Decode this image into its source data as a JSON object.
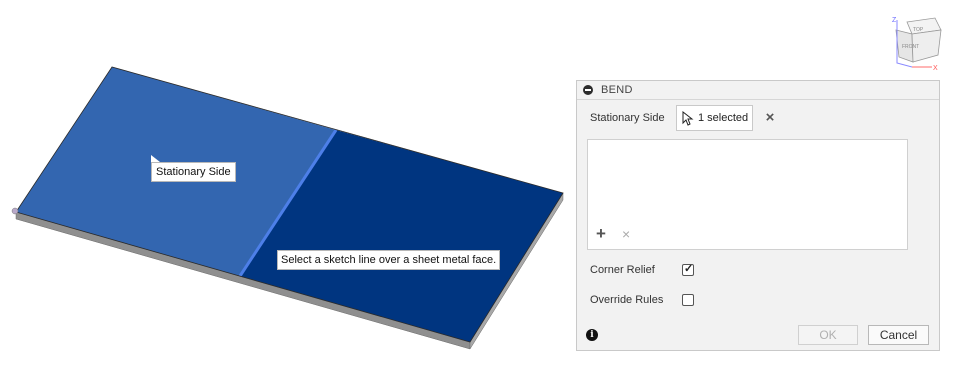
{
  "viewcube": {
    "top_label": "TOP",
    "front_label": "FRONT",
    "axis_z": "Z",
    "axis_x": "X"
  },
  "canvas": {
    "stationary_tooltip": "Stationary Side",
    "hint_tooltip": "Select a sketch line over a sheet metal face."
  },
  "colors": {
    "stationary_face": "#3366b0",
    "other_face": "#003580",
    "bend_line": "#4d7fe8",
    "edge": "#7d7d7d"
  },
  "panel": {
    "title": "BEND",
    "stationary_side_label": "Stationary Side",
    "selection_text": "1 selected",
    "clear_icon": "×",
    "add_icon": "+",
    "remove_icon": "×",
    "corner_relief_label": "Corner Relief",
    "corner_relief_checked": true,
    "override_rules_label": "Override Rules",
    "override_rules_checked": false,
    "info_icon": "i",
    "ok_label": "OK",
    "cancel_label": "Cancel"
  }
}
